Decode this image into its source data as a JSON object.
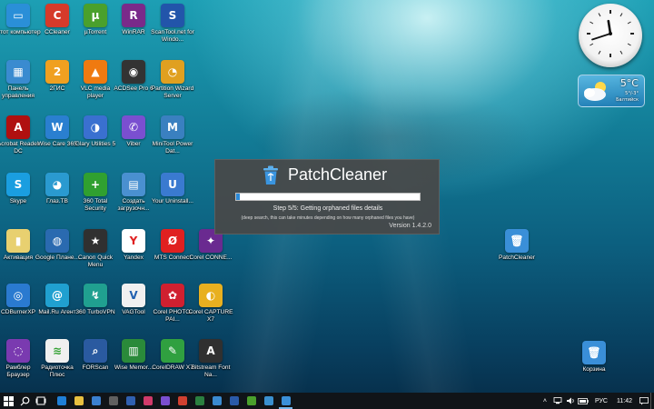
{
  "desktop_icons": [
    {
      "id": "this-pc",
      "label": "Этот компьютер",
      "color": "#2a8fd8",
      "glyph": "▭",
      "icon": "computer-icon"
    },
    {
      "id": "ccleaner",
      "label": "CCleaner",
      "color": "#d63a2a",
      "glyph": "C",
      "icon": "ccleaner-icon"
    },
    {
      "id": "utorrent",
      "label": "µTorrent",
      "color": "#4aa02c",
      "glyph": "µ",
      "icon": "utorrent-icon"
    },
    {
      "id": "winrar",
      "label": "WinRAR",
      "color": "#7a2a8a",
      "glyph": "R",
      "icon": "winrar-icon"
    },
    {
      "id": "scantool",
      "label": "ScanTool.net for Windo...",
      "color": "#2255aa",
      "glyph": "S",
      "icon": "scantool-icon"
    },
    {
      "id": "control-panel",
      "label": "Панель управления",
      "color": "#3a8bd0",
      "glyph": "▦",
      "icon": "control-panel-icon"
    },
    {
      "id": "2gis",
      "label": "2ГИС",
      "color": "#f0a020",
      "glyph": "2",
      "icon": "2gis-icon"
    },
    {
      "id": "vlc",
      "label": "VLC media player",
      "color": "#f07a10",
      "glyph": "▲",
      "icon": "vlc-icon"
    },
    {
      "id": "acdsee",
      "label": "ACDSee Pro 6",
      "color": "#333333",
      "glyph": "◉",
      "icon": "acdsee-icon"
    },
    {
      "id": "partition-wizard",
      "label": "Partition Wizard Server",
      "color": "#e0a020",
      "glyph": "◔",
      "icon": "partition-wizard-icon"
    },
    {
      "id": "acrobat",
      "label": "Acrobat Reader DC",
      "color": "#b01010",
      "glyph": "A",
      "icon": "acrobat-icon"
    },
    {
      "id": "wisecare",
      "label": "Wise Care 365",
      "color": "#2a7fd0",
      "glyph": "W",
      "icon": "wisecare-icon"
    },
    {
      "id": "glary",
      "label": "Glary Utilities 5",
      "color": "#3a70d0",
      "glyph": "◑",
      "icon": "glary-icon"
    },
    {
      "id": "viber",
      "label": "Viber",
      "color": "#7a4fd0",
      "glyph": "✆",
      "icon": "viber-icon"
    },
    {
      "id": "minitool",
      "label": "MiniTool Power Dat...",
      "color": "#3a80c0",
      "glyph": "M",
      "icon": "minitool-icon"
    },
    {
      "id": "skype",
      "label": "Skype",
      "color": "#1a9ee0",
      "glyph": "S",
      "icon": "skype-icon"
    },
    {
      "id": "glaz-tv",
      "label": "Глаз.ТВ",
      "color": "#2a9ad0",
      "glyph": "◕",
      "icon": "glaz-tv-icon"
    },
    {
      "id": "360-total",
      "label": "360 Total Security",
      "color": "#30a030",
      "glyph": "+",
      "icon": "360-total-icon"
    },
    {
      "id": "create-boot",
      "label": "Создать загрузочн...",
      "color": "#4a90d0",
      "glyph": "▤",
      "icon": "boot-disk-icon"
    },
    {
      "id": "your-uninstall",
      "label": "Your Uninstall...",
      "color": "#3a7ad0",
      "glyph": "U",
      "icon": "uninstall-icon"
    },
    {
      "id": "activation",
      "label": "Активация",
      "color": "#e8d070",
      "glyph": "▮",
      "icon": "activation-icon"
    },
    {
      "id": "google-earth",
      "label": "Google Плане...",
      "color": "#2a6ab0",
      "glyph": "◍",
      "icon": "google-earth-icon"
    },
    {
      "id": "canon-quick-menu",
      "label": "Canon Quick Menu",
      "color": "#303030",
      "glyph": "★",
      "icon": "canon-icon"
    },
    {
      "id": "yandex",
      "label": "Yandex",
      "color": "#ffffff",
      "glyph": "Y",
      "icon": "yandex-icon",
      "glyphColor": "#e02020"
    },
    {
      "id": "mts-connect",
      "label": "MTS Connect",
      "color": "#e02020",
      "glyph": "Ø",
      "icon": "mts-icon"
    },
    {
      "id": "corel-connect",
      "label": "Corel CONNE...",
      "color": "#6a2a90",
      "glyph": "✦",
      "icon": "corel-connect-icon"
    },
    {
      "id": "cdburnerxp",
      "label": "CDBurnerXP",
      "color": "#2a7ad0",
      "glyph": "◎",
      "icon": "cdburnerxp-icon"
    },
    {
      "id": "mailru",
      "label": "Mail.Ru Агент",
      "color": "#20a0d0",
      "glyph": "@",
      "icon": "mailru-icon"
    },
    {
      "id": "360-turbovpn",
      "label": "360 TurboVPN",
      "color": "#20a090",
      "glyph": "↯",
      "icon": "vpn-icon"
    },
    {
      "id": "vagtool",
      "label": "VAGTool",
      "color": "#f0f0f0",
      "glyph": "V",
      "icon": "vagtool-icon",
      "glyphColor": "#2060b0"
    },
    {
      "id": "corel-photo-paint",
      "label": "Corel PHOTO-PAI...",
      "color": "#d02030",
      "glyph": "✿",
      "icon": "corel-photo-paint-icon"
    },
    {
      "id": "corel-capture",
      "label": "Corel CAPTURE X7",
      "color": "#e8b020",
      "glyph": "◐",
      "icon": "corel-capture-icon"
    },
    {
      "id": "rambler",
      "label": "Рамблер Браузер",
      "color": "#7a3ab0",
      "glyph": "◌",
      "icon": "rambler-icon"
    },
    {
      "id": "radiotochka",
      "label": "Радиоточка Плюс",
      "color": "#f0f0f0",
      "glyph": "≋",
      "icon": "radio-icon",
      "glyphColor": "#30a030"
    },
    {
      "id": "forscan",
      "label": "FORScan",
      "color": "#2a5aa0",
      "glyph": "⌕",
      "icon": "forscan-icon"
    },
    {
      "id": "wise-memory",
      "label": "Wise Memor...",
      "color": "#2a8a3a",
      "glyph": "▥",
      "icon": "wise-memory-icon"
    },
    {
      "id": "coreldraw",
      "label": "CorelDRAW X7",
      "color": "#30a040",
      "glyph": "✎",
      "icon": "coreldraw-icon"
    },
    {
      "id": "bitstream",
      "label": "Bitstream Font Na...",
      "color": "#303030",
      "glyph": "A",
      "icon": "bitstream-icon"
    },
    {
      "id": "patchcleaner-desktop",
      "label": "PatchCleaner",
      "color": "#3a8fd8",
      "glyph": "🗑",
      "icon": "recycle-bin-icon"
    },
    {
      "id": "recycle-bin",
      "label": "Корзина",
      "color": "#3a8fd8",
      "glyph": "🗑",
      "icon": "recycle-bin-icon"
    }
  ],
  "clock": {
    "hour": 11,
    "minute": 42
  },
  "weather": {
    "temp": "5°C",
    "line1": "5°/-3°",
    "line2": "Балтийск"
  },
  "splash": {
    "title": "PatchCleaner",
    "progress": 0.02,
    "step": "Step 5/5: Getting orphaned files details",
    "note": "(deep search, this can take minutes depending on how many orphaned files you have)",
    "version": "Version 1.4.2.0"
  },
  "taskbar": {
    "apps": [
      {
        "id": "edge",
        "color": "#1f7fd6",
        "icon": "edge-icon"
      },
      {
        "id": "explorer",
        "color": "#e8c040",
        "icon": "folder-icon"
      },
      {
        "id": "store",
        "color": "#3a80d0",
        "icon": "store-icon"
      },
      {
        "id": "calc",
        "color": "#606060",
        "icon": "calculator-icon"
      },
      {
        "id": "media",
        "color": "#3060b0",
        "icon": "media-icon"
      },
      {
        "id": "paint",
        "color": "#d03a6a",
        "icon": "paint-icon"
      },
      {
        "id": "viber",
        "color": "#7a4fd0",
        "icon": "viber-icon"
      },
      {
        "id": "chrome",
        "color": "#d04030",
        "icon": "chrome-icon"
      },
      {
        "id": "excel",
        "color": "#2a8040",
        "icon": "excel-icon"
      },
      {
        "id": "photos",
        "color": "#3a8ad0",
        "icon": "photos-icon"
      },
      {
        "id": "word",
        "color": "#2a5aa8",
        "icon": "word-icon"
      },
      {
        "id": "utorrent",
        "color": "#4aa02c",
        "icon": "utorrent-icon"
      },
      {
        "id": "app",
        "color": "#3a90d0",
        "icon": "app-icon"
      },
      {
        "id": "patchcleaner",
        "color": "#3a8fd8",
        "icon": "patchcleaner-icon",
        "active": true
      }
    ],
    "lang": "РУС",
    "time": "11:42"
  }
}
